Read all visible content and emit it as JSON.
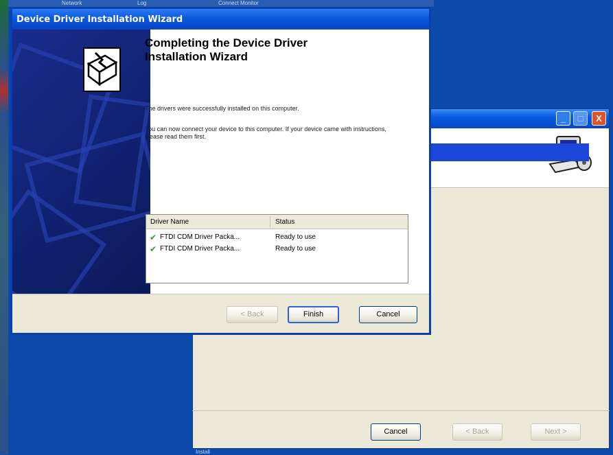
{
  "desktop": {
    "top_texts": [
      "Network",
      "Log",
      "Connect Monitor"
    ],
    "bottom_text": "Install"
  },
  "back_window": {
    "title_buttons": {
      "minimize": "_",
      "maximize": "□",
      "close": "X"
    },
    "cancel_label": "Cancel",
    "back_label": "< Back",
    "next_label": "Next >"
  },
  "wizard": {
    "window_title": "Device Driver Installation Wizard",
    "heading": "Completing the Device Driver Installation Wizard",
    "success_text": "The drivers were successfully installed on this computer.",
    "connect_text": "You can now connect your device to this computer. If your device came with instructions, please read them first.",
    "table": {
      "columns": [
        "Driver Name",
        "Status"
      ],
      "rows": [
        {
          "name": "FTDI CDM Driver Packa...",
          "status": "Ready to use"
        },
        {
          "name": "FTDI CDM Driver Packa...",
          "status": "Ready to use"
        }
      ]
    },
    "buttons": {
      "back": "< Back",
      "finish": "Finish",
      "cancel": "Cancel"
    }
  }
}
